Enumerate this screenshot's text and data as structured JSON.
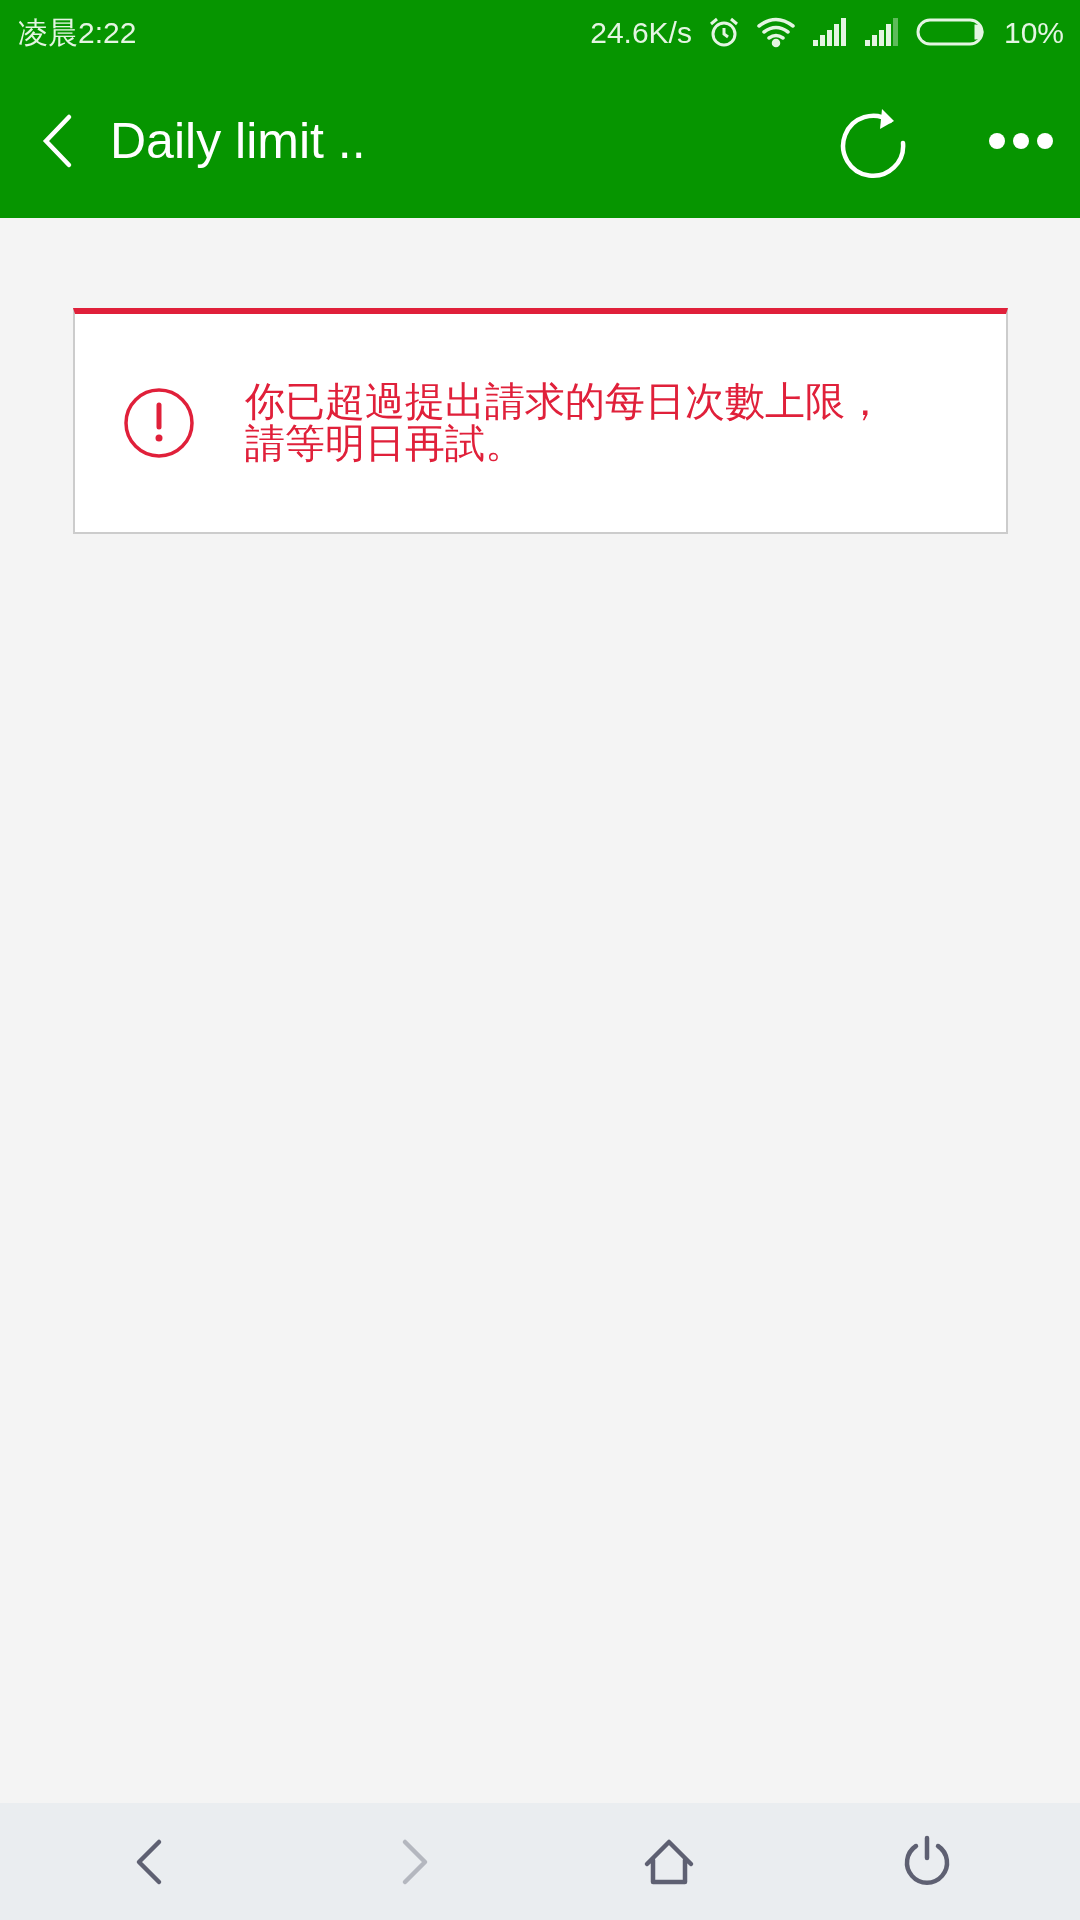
{
  "status_bar": {
    "time": "凌晨2:22",
    "net_speed": "24.6K/s",
    "battery": "10%"
  },
  "app_bar": {
    "title": "Daily limit .."
  },
  "alert": {
    "message": "你已超過提出請求的每日次數上限，請等明日再試。"
  },
  "bottom_nav": [
    {
      "kind": "back",
      "disabled": false
    },
    {
      "kind": "forward",
      "disabled": true
    },
    {
      "kind": "home",
      "disabled": false
    },
    {
      "kind": "power",
      "disabled": false
    }
  ]
}
